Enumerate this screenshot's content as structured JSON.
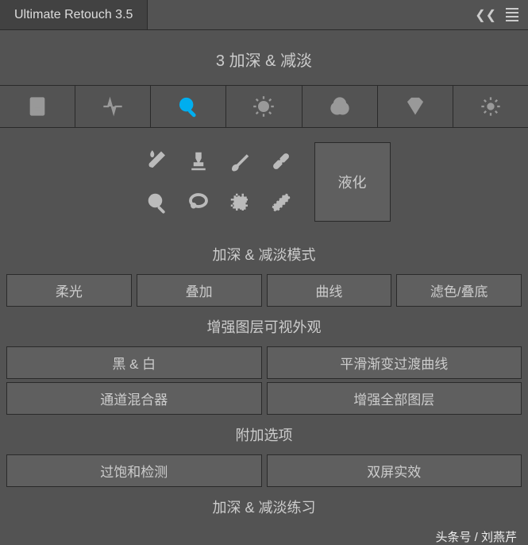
{
  "header": {
    "app_title": "Ultimate Retouch 3.5"
  },
  "section": {
    "title": "3 加深 & 减淡"
  },
  "tools": {
    "liquify_label": "液化"
  },
  "mode": {
    "label": "加深 & 减淡模式",
    "buttons": [
      "柔光",
      "叠加",
      "曲线",
      "滤色/叠底"
    ]
  },
  "enhance": {
    "label": "增强图层可视外观",
    "row1": [
      "黑 & 白",
      "平滑渐变过渡曲线"
    ],
    "row2": [
      "通道混合器",
      "增强全部图层"
    ]
  },
  "extra": {
    "label": "附加选项",
    "row1": [
      "过饱和检测",
      "双屏实效"
    ],
    "bottom": "加深 & 减淡练习"
  },
  "footer": {
    "credit": "头条号 / 刘燕芹"
  }
}
